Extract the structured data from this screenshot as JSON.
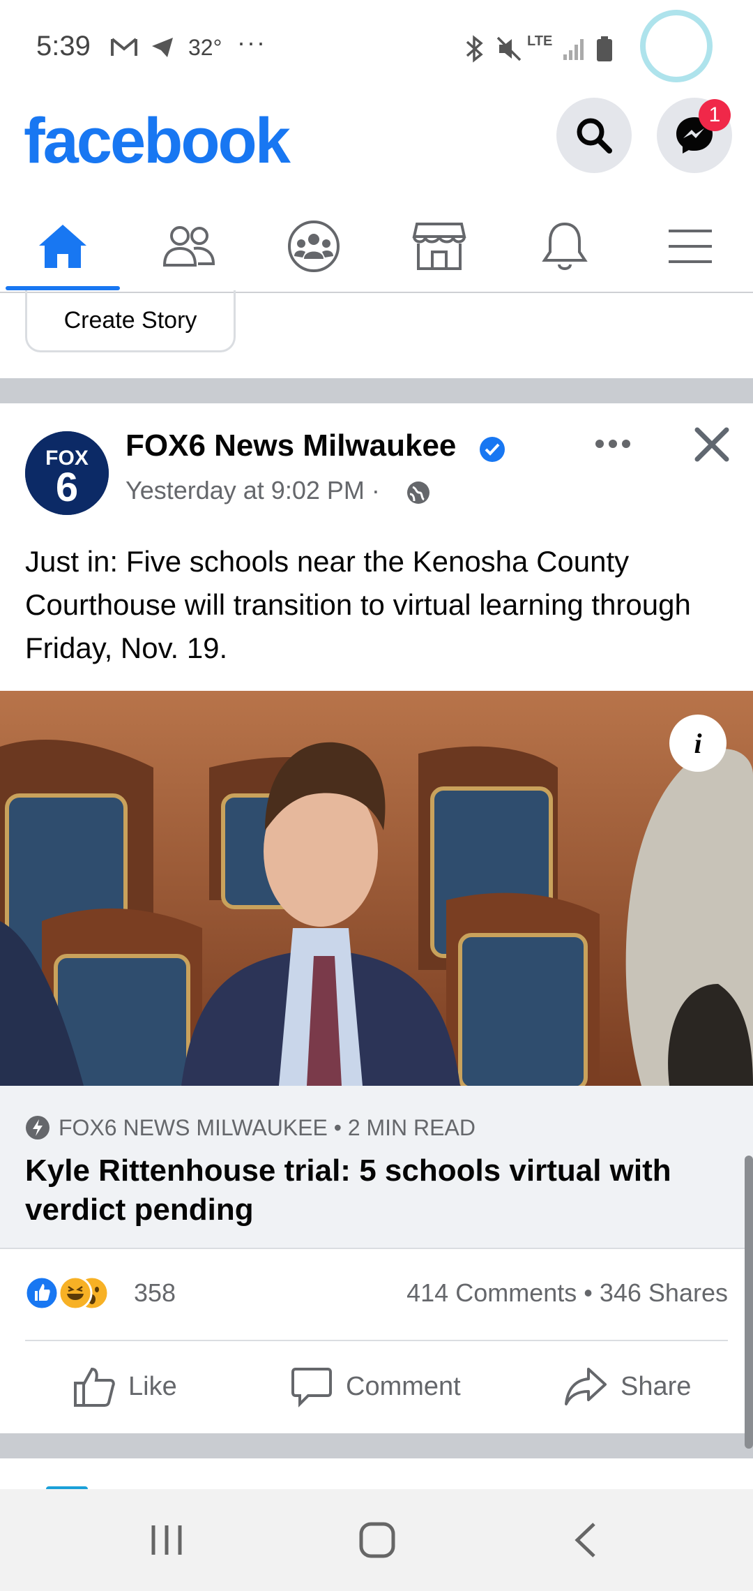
{
  "status_bar": {
    "time": "5:39",
    "temperature": "32°",
    "more": "···",
    "network": "LTE"
  },
  "header": {
    "logo": "facebook",
    "messenger_badge": "1"
  },
  "tabs": [
    "home",
    "friends",
    "groups",
    "marketplace",
    "notifications",
    "menu"
  ],
  "stories": {
    "create_label": "Create Story"
  },
  "post": {
    "avatar_text_top": "FOX",
    "avatar_text_bottom": "6",
    "page_name": "FOX6 News Milwaukee",
    "time": "Yesterday at 9:02 PM · ",
    "text": "Just in: Five schools near the Kenosha County Courthouse will transition to virtual learning through Friday, Nov. 19.",
    "link_source": "FOX6 NEWS MILWAUKEE • 2 MIN READ",
    "link_title": "Kyle Rittenhouse trial: 5 schools virtual with verdict pending",
    "reaction_count": "358",
    "stats": "414 Comments • 346 Shares",
    "actions": {
      "like": "Like",
      "comment": "Comment",
      "share": "Share"
    }
  },
  "colors": {
    "brand": "#1877f2",
    "badge": "#f02849",
    "text_secondary": "#65676b"
  }
}
